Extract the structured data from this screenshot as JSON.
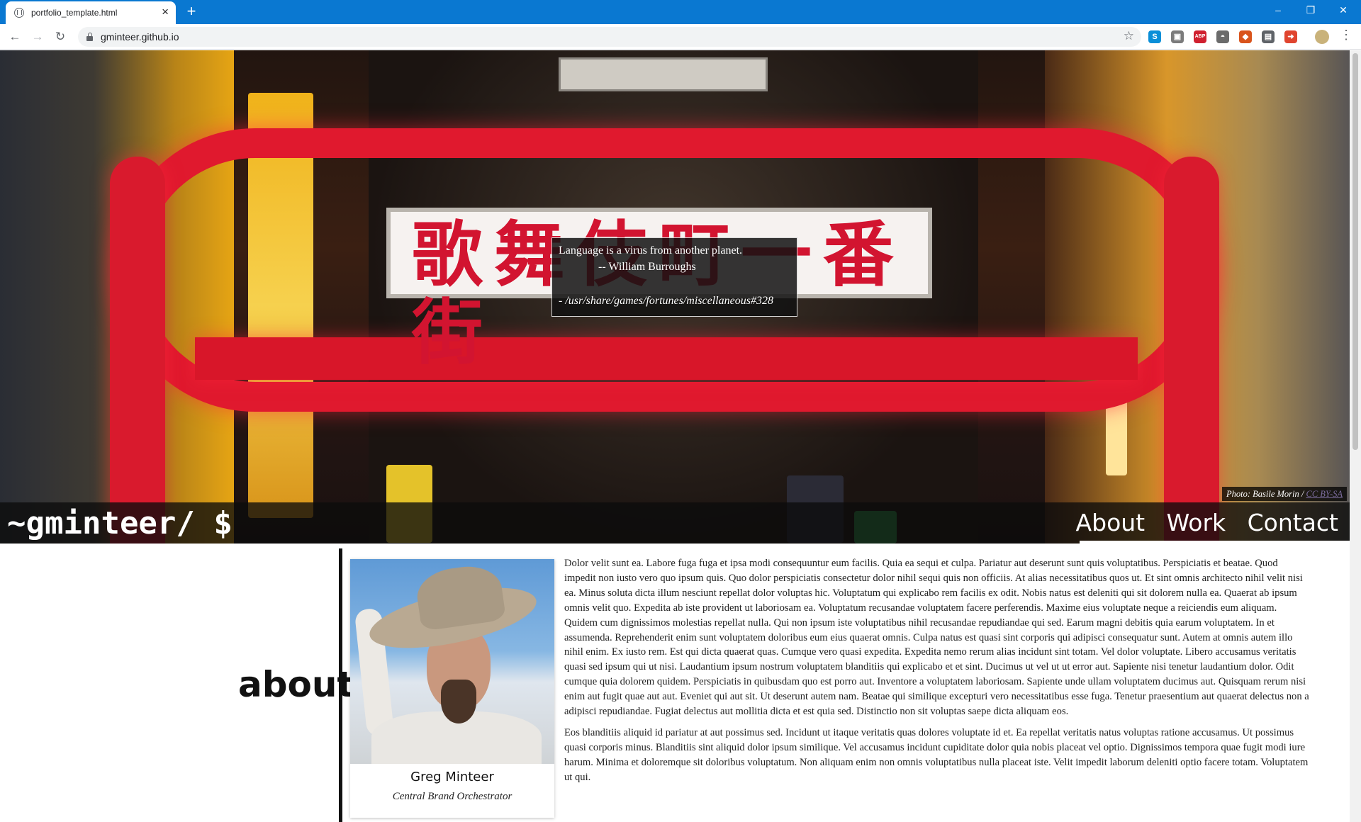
{
  "browser": {
    "tab_title": "portfolio_template.html",
    "tab_close": "×",
    "new_tab": "+",
    "url": "gminteer.github.io",
    "window_controls": {
      "minimize": "–",
      "restore": "❐",
      "close": "✕"
    },
    "extensions": [
      {
        "name": "skype-extension",
        "label": "S",
        "color": "#0a8fd8"
      },
      {
        "name": "page-capture-extension",
        "label": "▣",
        "color": "#7b7b7b"
      },
      {
        "name": "adblock-extension",
        "label": "ABP",
        "color": "#d0202f"
      },
      {
        "name": "incognito-extension",
        "label": "◓",
        "color": "#6b6b6b"
      },
      {
        "name": "coupon-extension",
        "label": "◆",
        "color": "#d9541c"
      },
      {
        "name": "briefcase-extension",
        "label": "▤",
        "color": "#5f6368"
      },
      {
        "name": "share-extension",
        "label": "➜",
        "color": "#e0452f"
      }
    ]
  },
  "hero": {
    "quote_line1": "Language is a virus from another planet.",
    "quote_line2": "-- William Burroughs",
    "quote_source": "- /usr/share/games/fortunes/miscellaneous#328",
    "photo_credit": "Photo: Basile Morin /",
    "photo_license": "CC BY-SA",
    "sign_text": "歌舞伎町一番街"
  },
  "nav": {
    "logo": "~gminteer/ $",
    "links": [
      "About",
      "Work",
      "Contact"
    ]
  },
  "about": {
    "heading": "about",
    "name": "Greg Minteer",
    "title": "Central Brand Orchestrator",
    "paragraphs": [
      "Dolor velit sunt ea. Labore fuga fuga et ipsa modi consequuntur eum facilis. Quia ea sequi et culpa. Pariatur aut deserunt sunt quis voluptatibus. Perspiciatis et beatae. Quod impedit non iusto vero quo ipsum quis. Quo dolor perspiciatis consectetur dolor nihil sequi quis non officiis. At alias necessitatibus quos ut. Et sint omnis architecto nihil velit nisi ea. Minus soluta dicta illum nesciunt repellat dolor voluptas hic. Voluptatum qui explicabo rem facilis ex odit. Nobis natus est deleniti qui sit dolorem nulla ea. Quaerat ab ipsum omnis velit quo. Expedita ab iste provident ut laboriosam ea. Voluptatum recusandae voluptatem facere perferendis. Maxime eius voluptate neque a reiciendis eum aliquam. Quidem cum dignissimos molestias repellat nulla. Qui non ipsum iste voluptatibus nihil recusandae repudiandae qui sed. Earum magni debitis quia earum voluptatem. In et assumenda. Reprehenderit enim sunt voluptatem doloribus eum eius quaerat omnis. Culpa natus est quasi sint corporis qui adipisci consequatur sunt. Autem at omnis autem illo nihil enim. Ex iusto rem. Est qui dicta quaerat quas. Cumque vero quasi expedita. Expedita nemo rerum alias incidunt sint totam. Vel dolor voluptate. Libero accusamus veritatis quasi sed ipsum qui ut nisi. Laudantium ipsum nostrum voluptatem blanditiis qui explicabo et et sint. Ducimus ut vel ut ut error aut. Sapiente nisi tenetur laudantium dolor. Odit cumque quia dolorem quidem. Perspiciatis in quibusdam quo est porro aut. Inventore a voluptatem laboriosam. Sapiente unde ullam voluptatem ducimus aut. Quisquam rerum nisi enim aut fugit quae aut aut. Eveniet qui aut sit. Ut deserunt autem nam. Beatae qui similique excepturi vero necessitatibus esse fuga. Tenetur praesentium aut quaerat delectus non a adipisci repudiandae. Fugiat delectus aut mollitia dicta et est quia sed. Distinctio non sit voluptas saepe dicta aliquam eos.",
      "Eos blanditiis aliquid id pariatur at aut possimus sed. Incidunt ut itaque veritatis quas dolores voluptate id et. Ea repellat veritatis natus voluptas ratione accusamus. Ut possimus quasi corporis minus. Blanditiis sint aliquid dolor ipsum similique. Vel accusamus incidunt cupiditate dolor quia nobis placeat vel optio. Dignissimos tempora quae fugit modi iure harum. Minima et doloremque sit doloribus voluptatum. Non aliquam enim non omnis voluptatibus nulla placeat iste. Velit impedit laborum deleniti optio facere totam. Voluptatem ut qui."
    ]
  }
}
